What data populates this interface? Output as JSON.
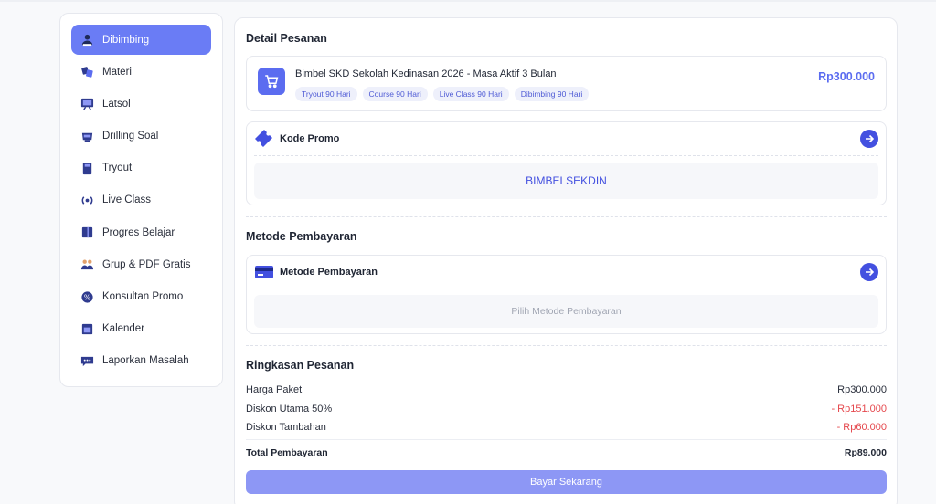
{
  "sidebar": {
    "items": [
      {
        "label": "Dibimbing",
        "icon": "mentor-icon",
        "active": true
      },
      {
        "label": "Materi",
        "icon": "materials-icon",
        "active": false
      },
      {
        "label": "Latsol",
        "icon": "practice-board-icon",
        "active": false
      },
      {
        "label": "Drilling Soal",
        "icon": "drilling-icon",
        "active": false
      },
      {
        "label": "Tryout",
        "icon": "tryout-book-icon",
        "active": false
      },
      {
        "label": "Live Class",
        "icon": "broadcast-icon",
        "active": false
      },
      {
        "label": "Progres Belajar",
        "icon": "progress-book-icon",
        "active": false
      },
      {
        "label": "Grup & PDF Gratis",
        "icon": "group-icon",
        "active": false
      },
      {
        "label": "Konsultan Promo",
        "icon": "promo-badge-icon",
        "active": false
      },
      {
        "label": "Kalender",
        "icon": "calendar-icon",
        "active": false
      },
      {
        "label": "Laporkan Masalah",
        "icon": "chat-report-icon",
        "active": false
      }
    ]
  },
  "order": {
    "section_title": "Detail Pesanan",
    "product_title": "Bimbel SKD Sekolah Kedinasan 2026 - Masa Aktif 3 Bulan",
    "tags": [
      "Tryout 90 Hari",
      "Course 90 Hari",
      "Live Class 90 Hari",
      "Dibimbing 90 Hari"
    ],
    "price": "Rp300.000"
  },
  "promo": {
    "label": "Kode Promo",
    "value": "BIMBELSEKDIN"
  },
  "payment": {
    "section_title": "Metode Pembayaran",
    "label": "Metode Pembayaran",
    "placeholder": "Pilih Metode Pembayaran"
  },
  "summary": {
    "section_title": "Ringkasan Pesanan",
    "rows": [
      {
        "label": "Harga Paket",
        "value": "Rp300.000"
      },
      {
        "label": "Diskon Utama 50%",
        "value": "- Rp151.000"
      },
      {
        "label": "Diskon Tambahan",
        "value": "- Rp60.000"
      }
    ],
    "total_label": "Total Pembayaran",
    "total_value": "Rp89.000"
  },
  "pay_button_label": "Bayar Sekarang",
  "colors": {
    "accent": "#5b6cf0",
    "sidebar_active": "#6a7cf5",
    "button": "#8d97f5",
    "discount": "#e5484d"
  }
}
